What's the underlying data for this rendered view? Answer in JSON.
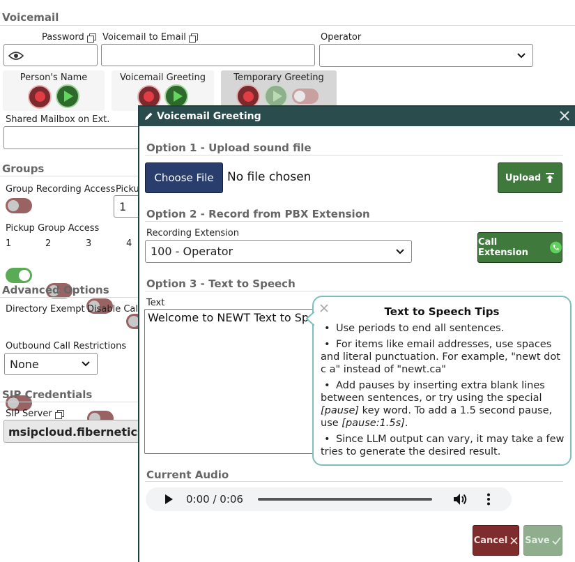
{
  "voicemail": {
    "section_title": "Voicemail",
    "password_label": "Password",
    "vm_to_email_label": "Voicemail to Email",
    "operator_label": "Operator",
    "operator_value": "",
    "persons_name_label": "Person's Name",
    "vm_greeting_label": "Voicemail Greeting",
    "temp_greeting_label": "Temporary Greeting",
    "shared_mailbox_label": "Shared Mailbox on Ext."
  },
  "groups": {
    "section_title": "Groups",
    "group_recording_label": "Group Recording Access",
    "pickup_partial_label": "Picku",
    "pickup_select_value": "1",
    "pickup_group_access_label": "Pickup Group Access",
    "pickup_groups": [
      "1",
      "2",
      "3",
      "4"
    ]
  },
  "advanced": {
    "section_title": "Advanced Options",
    "directory_exempt_label": "Directory Exempt",
    "disable_call_partial_label": "Disable Call",
    "outbound_label": "Outbound Call Restrictions",
    "outbound_value": "None"
  },
  "sip": {
    "section_title": "SIP Credentials",
    "server_label": "SIP Server",
    "server_value": "msipcloud.fibernetics.c"
  },
  "modal": {
    "title": "Voicemail Greeting",
    "option1_title": "Option 1 - Upload sound file",
    "choose_file_label": "Choose File",
    "no_file_text": "No file chosen",
    "upload_label": "Upload",
    "option2_title": "Option 2 - Record from PBX Extension",
    "recording_ext_label": "Recording Extension",
    "recording_ext_value": "100 - Operator",
    "call_extension_label": "Call Extension",
    "option3_title": "Option 3 - Text to Speech",
    "text_label": "Text",
    "text_value": "Welcome to NEWT Text to Speech",
    "current_audio_title": "Current Audio",
    "audio_time": "0:00 / 0:06",
    "audio_progress": 0,
    "cancel_label": "Cancel",
    "save_label": "Save"
  },
  "tips": {
    "title": "Text to Speech Tips",
    "t1": "Use periods to end all sentences.",
    "t2": "For items like email addresses, use spaces and literal punctuation. For example, \"newt dot c a\" instead of \"newt.ca\"",
    "t3a": "Add pauses by inserting extra blank lines between sentences, or try using the special ",
    "t3b": "[pause]",
    "t3c": " key word. To add a 1.5 second pause, use ",
    "t3d": "[pause:1.5s]",
    "t3e": ".",
    "t4": "Since LLM output can vary, it may take a few tries to generate the desired result."
  },
  "colors": {
    "modal_header": "#2b4c4d",
    "green_button": "#3f7a3c",
    "navy_button": "#293e6c",
    "cancel_button": "#7e2c2c",
    "save_button": "#8fae8d",
    "tips_border": "#7cbfbc"
  }
}
